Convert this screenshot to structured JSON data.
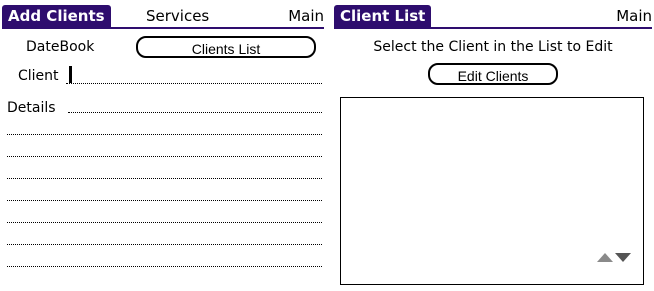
{
  "left_form": {
    "title": "Add Clients",
    "menu_services": "Services",
    "menu_main": "Main",
    "datebook_label": "DateBook",
    "clients_list_button": "Clients List",
    "client_label": "Client",
    "client_value": "",
    "details_label": "Details",
    "details_value": ""
  },
  "right_form": {
    "title": "Client List",
    "menu_main": "Main",
    "instruction": "Select the Client in the List to Edit",
    "edit_button": "Edit Clients",
    "list_items": []
  },
  "colors": {
    "title_background": "#2e0d6e",
    "title_text": "#ffffff"
  },
  "icons": {
    "scroll_up": "scroll-up-arrow",
    "scroll_down": "scroll-down-arrow"
  }
}
